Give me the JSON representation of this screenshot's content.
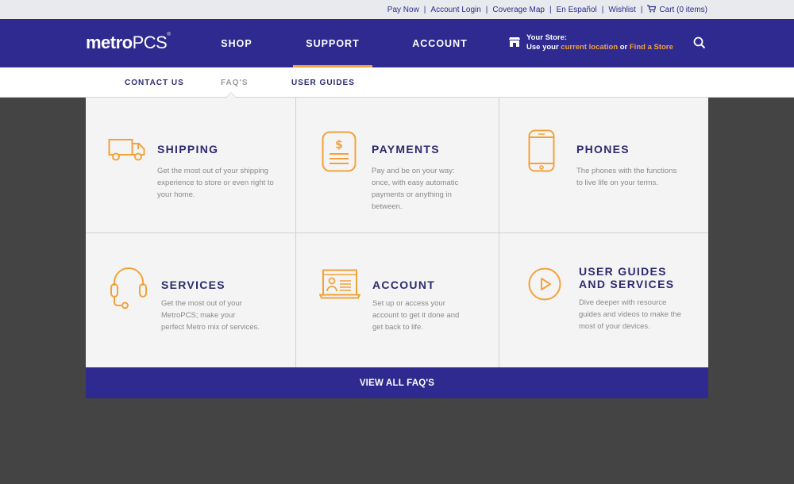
{
  "util_bar": {
    "links": [
      "Pay Now",
      "Account Login",
      "Coverage Map",
      "En Español",
      "Wishlist"
    ],
    "cart_label": "Cart (0 items)",
    "cart_icon": "cart-icon"
  },
  "header": {
    "logo_bold": "metro",
    "logo_light": "PCS",
    "nav": [
      "SHOP",
      "SUPPORT",
      "ACCOUNT"
    ],
    "active_nav": "SUPPORT",
    "store_label": "Your Store:",
    "store_use": "Use your ",
    "store_current_location": "current location",
    "store_or": " or ",
    "store_find": "Find a Store",
    "store_icon": "store-icon",
    "search_icon": "search-icon"
  },
  "sub_nav": {
    "items": [
      "CONTACT US",
      "FAQ'S",
      "USER GUIDES"
    ],
    "active": "FAQ'S"
  },
  "panel": {
    "cards": [
      {
        "title": "SHIPPING",
        "description": "Get the most out of your shipping experience to store or even right to your home.",
        "icon": "truck-icon"
      },
      {
        "title": "PAYMENTS",
        "description": "Pay and be on your way: once, with easy automatic payments or anything in between.",
        "icon": "invoice-icon"
      },
      {
        "title": "PHONES",
        "description": "The phones with the functions to live life on your terms.",
        "icon": "phone-icon"
      },
      {
        "title": "SERVICES",
        "description": "Get the most out of your MetroPCS; make your perfect Metro mix of services.",
        "icon": "headset-icon"
      },
      {
        "title": "ACCOUNT",
        "description": "Set up or access your account to get it done and get back to life.",
        "icon": "account-window-icon"
      },
      {
        "title_line1": "USER GUIDES",
        "title_line2": "AND SERVICES",
        "description": "Dive deeper with resource guides and videos to make the most of your devices.",
        "icon": "play-icon"
      }
    ],
    "view_all_label": "VIEW ALL FAQ'S"
  },
  "colors": {
    "brand_purple": "#2e2a8f",
    "accent_orange": "#f3a23a",
    "title_navy": "#2e2a6e",
    "background_dark": "#444444"
  }
}
